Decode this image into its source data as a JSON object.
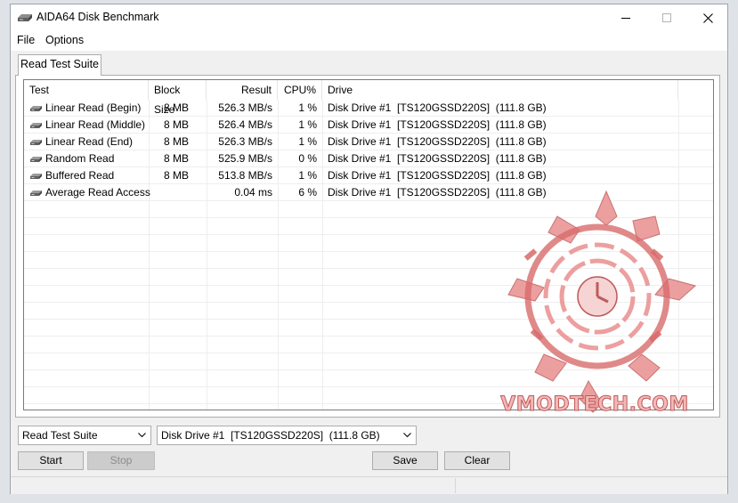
{
  "window": {
    "title": "AIDA64 Disk Benchmark",
    "icons": {
      "app": "disk-drive-icon",
      "minimize": "minimize-icon",
      "maximize": "maximize-icon",
      "close": "close-icon"
    }
  },
  "menu": {
    "items": [
      "File",
      "Options"
    ]
  },
  "tabs": [
    {
      "label": "Read Test Suite",
      "active": true
    }
  ],
  "table": {
    "columns": [
      "Test",
      "Block Size",
      "Result",
      "CPU%",
      "Drive"
    ],
    "rows": [
      {
        "test": "Linear Read (Begin)",
        "block_size": "8 MB",
        "result": "526.3 MB/s",
        "cpu": "1 %",
        "drive": "Disk Drive #1  [TS120GSSD220S]  (111.8 GB)"
      },
      {
        "test": "Linear Read (Middle)",
        "block_size": "8 MB",
        "result": "526.4 MB/s",
        "cpu": "1 %",
        "drive": "Disk Drive #1  [TS120GSSD220S]  (111.8 GB)"
      },
      {
        "test": "Linear Read (End)",
        "block_size": "8 MB",
        "result": "526.3 MB/s",
        "cpu": "1 %",
        "drive": "Disk Drive #1  [TS120GSSD220S]  (111.8 GB)"
      },
      {
        "test": "Random Read",
        "block_size": "8 MB",
        "result": "525.9 MB/s",
        "cpu": "0 %",
        "drive": "Disk Drive #1  [TS120GSSD220S]  (111.8 GB)"
      },
      {
        "test": "Buffered Read",
        "block_size": "8 MB",
        "result": "513.8 MB/s",
        "cpu": "1 %",
        "drive": "Disk Drive #1  [TS120GSSD220S]  (111.8 GB)"
      },
      {
        "test": "Average Read Access",
        "block_size": "",
        "result": "0.04 ms",
        "cpu": "6 %",
        "drive": "Disk Drive #1  [TS120GSSD220S]  (111.8 GB)"
      }
    ]
  },
  "watermark": {
    "text": "VMODTECH.COM",
    "logo": "vmodtech-logo"
  },
  "controls": {
    "suite_select": "Read Test Suite",
    "drive_select": "Disk Drive #1  [TS120GSSD220S]  (111.8 GB)",
    "start": "Start",
    "stop": "Stop",
    "save": "Save",
    "clear": "Clear"
  },
  "colors": {
    "watermark": "#e98f8f",
    "watermark_dark": "#c05a5a",
    "window_bg": "#f0f0f0",
    "accent_border": "#adadad"
  }
}
